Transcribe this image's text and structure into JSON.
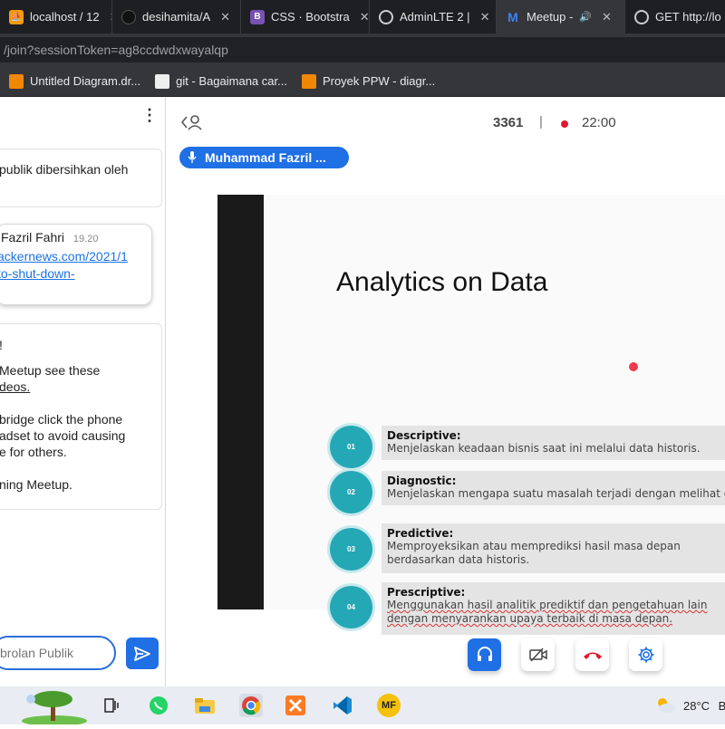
{
  "browser": {
    "tabs": [
      {
        "label": "localhost / 12",
        "icon": "phpmyadmin-icon"
      },
      {
        "label": "desihamita/A",
        "icon": "github-icon"
      },
      {
        "label": "CSS · Bootstra",
        "icon": "bootstrap-icon"
      },
      {
        "label": "AdminLTE 2 |",
        "icon": "globe-icon"
      },
      {
        "label": "Meetup -",
        "icon": "meetup-icon"
      },
      {
        "label": "GET http://lo",
        "icon": "globe-icon"
      }
    ],
    "url": "/join?sessionToken=ag8ccdwdxwayalqp",
    "bookmarks": [
      {
        "label": "Untitled Diagram.dr...",
        "icon": "drawio-icon"
      },
      {
        "label": "git - Bagaimana car...",
        "icon": "stackoverflow-icon"
      },
      {
        "label": "Proyek PPW - diagr...",
        "icon": "drawio-icon"
      }
    ]
  },
  "chat": {
    "messages": [
      {
        "text": "publik dibersihkan oleh"
      },
      {
        "author": "Fazril Fahri",
        "time": "19.20",
        "link_lines": [
          "ackernews.com/2021/1",
          "to-shut-down-"
        ]
      },
      {
        "lines": [
          "!",
          "Meetup see these",
          "deos.",
          "bridge click the phone",
          "adset to avoid causing",
          "e for others.",
          "ning Meetup."
        ]
      }
    ],
    "input_placeholder": "brolan Publik"
  },
  "meeting": {
    "meeting_id": "3361",
    "separator": "|",
    "duration": "22:00",
    "presenter": "Muhammad Fazril ...",
    "slide": {
      "title": "Analytics on Data",
      "items": [
        {
          "num": "01",
          "heading": "Descriptive:",
          "desc": "Menjelaskan keadaan bisnis saat ini melalui data historis."
        },
        {
          "num": "02",
          "heading": "Diagnostic:",
          "desc": "Menjelaskan mengapa suatu masalah terjadi dengan melihat da"
        },
        {
          "num": "03",
          "heading": "Predictive:",
          "desc": "Memproyeksikan atau memprediksi hasil masa depan berdasarkan data historis."
        },
        {
          "num": "04",
          "heading": "Prescriptive:",
          "desc": "Menggunakan hasil analitik prediktif dan pengetahuan lain dengan menyarankan upaya terbaik di masa depan."
        }
      ]
    },
    "controls": [
      "headset-icon",
      "camera-off-icon",
      "hang-up-icon",
      "gear-icon"
    ]
  },
  "taskbar": {
    "weather": "28°C",
    "weather_trailing": "B",
    "apps": [
      "task-view-icon",
      "whatsapp-icon",
      "file-explorer-icon",
      "chrome-icon",
      "xampp-icon",
      "vscode-icon",
      "meetup-mf-icon"
    ],
    "mf_label": "MF"
  },
  "colors": {
    "accent": "#1f6fe5",
    "slide_teal": "#25a8b5",
    "rec": "#e3162a"
  }
}
